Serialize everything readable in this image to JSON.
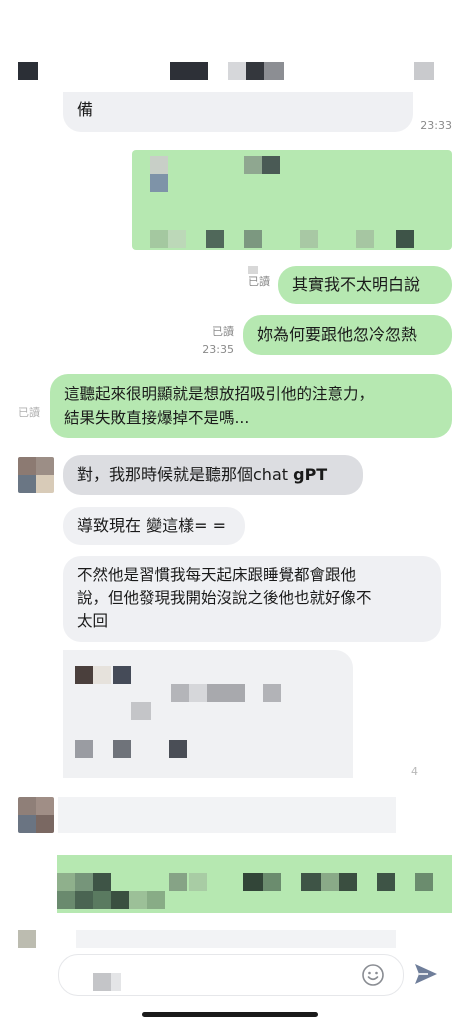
{
  "header": {
    "title_placeholder": ""
  },
  "messages": {
    "m1": {
      "text": "備",
      "time": "23:33"
    },
    "m3": {
      "text": "其實我不太明白說",
      "read": "已讀"
    },
    "m4": {
      "text": "妳為何要跟他忽冷忽熱",
      "read": "已讀",
      "time": "23:35"
    },
    "m5": {
      "line1": "這聽起來很明顯就是想放招吸引他的注意力，",
      "line2": "結果失敗直接爆掉不是嗎...",
      "read": "已讀"
    },
    "m6": {
      "text_pre": "對，我那時候就是聽那個chat ",
      "text_bold": "gPT"
    },
    "m7": {
      "text": "導致現在 變這樣= ="
    },
    "m8": {
      "line1": "不然他是習慣我每天起床跟睡覺都會跟他",
      "line2": "說，但他發現我開始沒說之後他也就好像不",
      "line3": "太回"
    },
    "m9": {
      "time_fragment": "4"
    }
  },
  "colors": {
    "incoming_bubble": "#eff0f3",
    "outgoing_bubble": "#b6e8b1",
    "send_icon": "#6f7e9a"
  },
  "composer": {
    "emoji_icon": "smile-icon",
    "send_icon": "send-icon"
  }
}
